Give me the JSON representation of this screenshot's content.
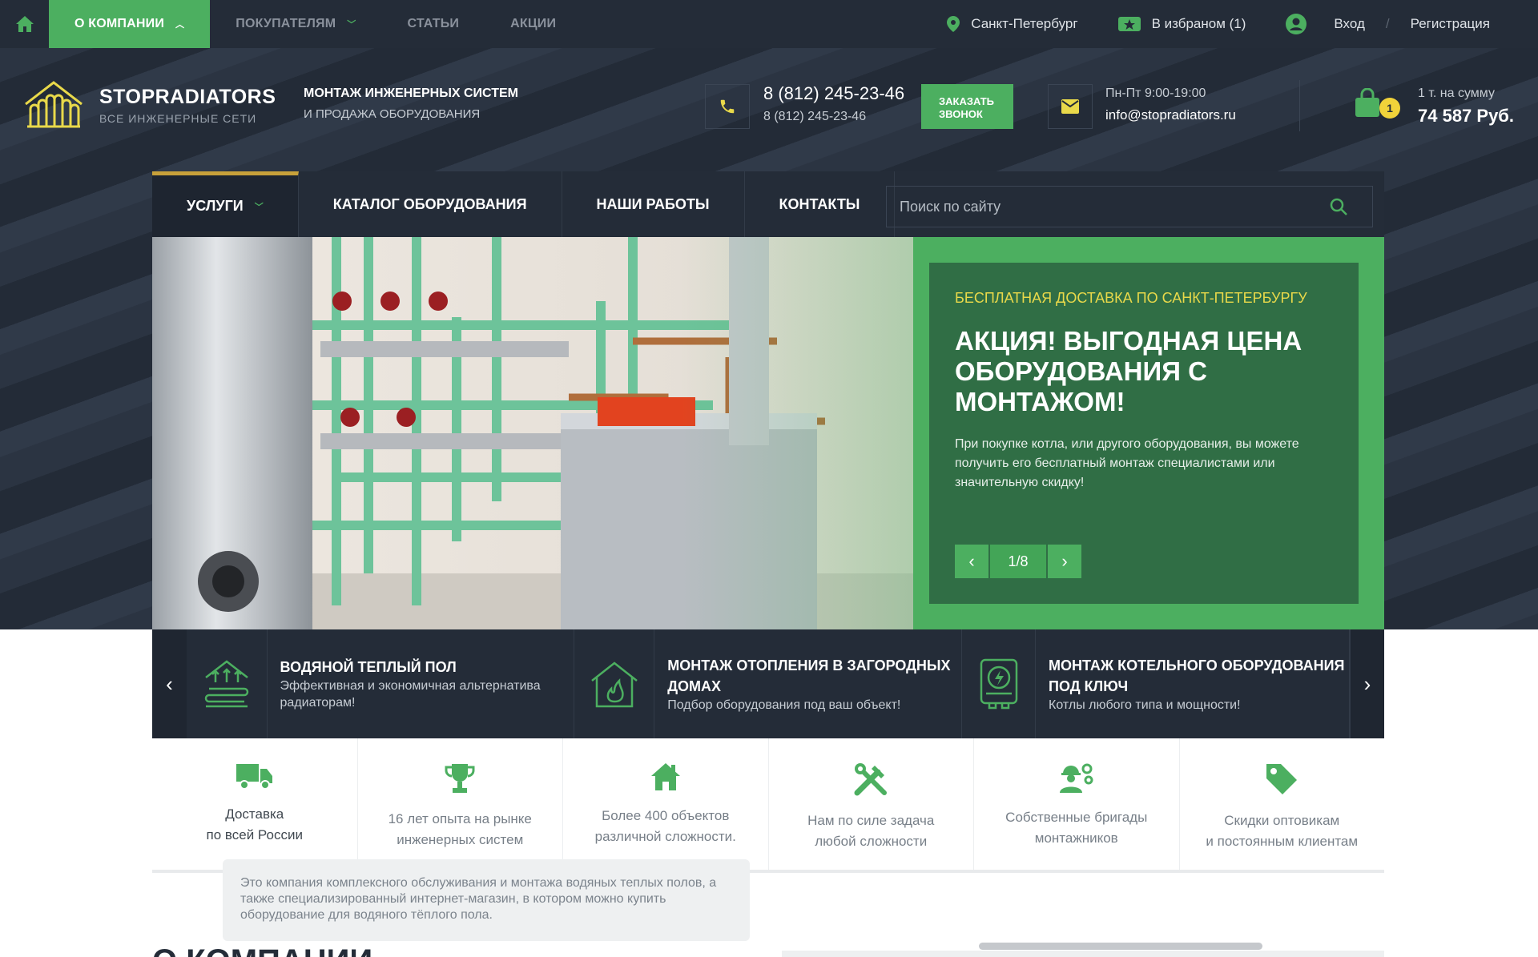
{
  "topbar": {
    "nav": [
      {
        "label": "О компании",
        "active": true,
        "dropdown": true
      },
      {
        "label": "Покупателям",
        "active": false,
        "dropdown": true
      },
      {
        "label": "Статьи",
        "active": false,
        "dropdown": false
      },
      {
        "label": "Акции",
        "active": false,
        "dropdown": false
      }
    ],
    "city": "Санкт-Петербург",
    "favorites": "В избраном (1)",
    "login": "Вход",
    "separator": "/",
    "register": "Регистрация"
  },
  "header": {
    "logo_title": "STOPRADIATORS",
    "logo_subtitle": "ВСЕ ИНЖЕНЕРНЫЕ СЕТИ",
    "tagline_1": "МОНТАЖ ИНЖЕНЕРНЫХ СИСТЕМ",
    "tagline_2": "И ПРОДАЖА ОБОРУДОВАНИЯ",
    "phone_main": "8 (812) 245-23-46",
    "phone_sub": "8 (812) 245-23-46",
    "callback_label_1": "ЗАКАЗАТЬ",
    "callback_label_2": "ЗВОНОК",
    "hours": "Пн-Пт 9:00-19:00",
    "email": "info@stopradiators.ru",
    "cart_count": "1",
    "cart_label": "1 т. на сумму",
    "cart_sum": "74 587 Руб."
  },
  "mainnav": {
    "items": [
      {
        "label": "Услуги",
        "active": true
      },
      {
        "label": "Каталог оборудования",
        "active": false
      },
      {
        "label": "Наши работы",
        "active": false
      },
      {
        "label": "Контакты",
        "active": false
      }
    ],
    "search_placeholder": "Поиск по сайту"
  },
  "slider": {
    "kicker": "БЕСПЛАТНАЯ ДОСТАВКА ПО САНКТ-ПЕТЕРБУРГУ",
    "title": "АКЦИЯ! ВЫГОДНАЯ ЦЕНА ОБОРУДОВАНИЯ С МОНТАЖОМ!",
    "text": "При покупке котла, или другого оборудования, вы можете получить его бесплатный монтаж специалистами или значительную скидку!",
    "counter": "1/8"
  },
  "services": [
    {
      "title": "ВОДЯНОЙ ТЕПЛЫЙ ПОЛ",
      "sub": "Эффективная и экономичная альтернатива радиаторам!",
      "icon": "heated-floor-icon"
    },
    {
      "title": "МОНТАЖ ОТОПЛЕНИЯ В ЗАГОРОДНЫХ ДОМАХ",
      "sub": "Подбор оборудования под ваш объект!",
      "icon": "house-fire-icon"
    },
    {
      "title": "МОНТАЖ КОТЕЛЬНОГО ОБОРУДОВАНИЯ ПОД КЛЮЧ",
      "sub": "Котлы любого типа и мощности!",
      "icon": "boiler-icon"
    }
  ],
  "features": [
    {
      "l1": "Доставка",
      "l2": "по всей России",
      "icon": "truck-icon"
    },
    {
      "l1": "16 лет опыта на рынке",
      "l2": "инженерных систем",
      "icon": "trophy-icon"
    },
    {
      "l1": "Более 400 объектов",
      "l2": "различной сложности.",
      "icon": "house-icon"
    },
    {
      "l1": "Нам по силе задача",
      "l2": "любой сложности",
      "icon": "tools-icon"
    },
    {
      "l1": "Собственные бригады",
      "l2": "монтажников",
      "icon": "workers-icon"
    },
    {
      "l1": "Скидки оптовикам",
      "l2": "и постоянным клиентам",
      "icon": "tag-icon"
    }
  ],
  "tooltip": "Это компания комплексного обслуживания и монтажа водяных теплых полов, а также специализированный интернет-магазин, в котором можно купить оборудование для водяного тёплого пола.",
  "about_title": "О КОМПАНИИ",
  "colors": {
    "accent": "#4caf60",
    "dark": "#242c38",
    "promo": "#306e45",
    "kicker": "#e9d94a",
    "nav_active_border": "#c8a13a"
  }
}
